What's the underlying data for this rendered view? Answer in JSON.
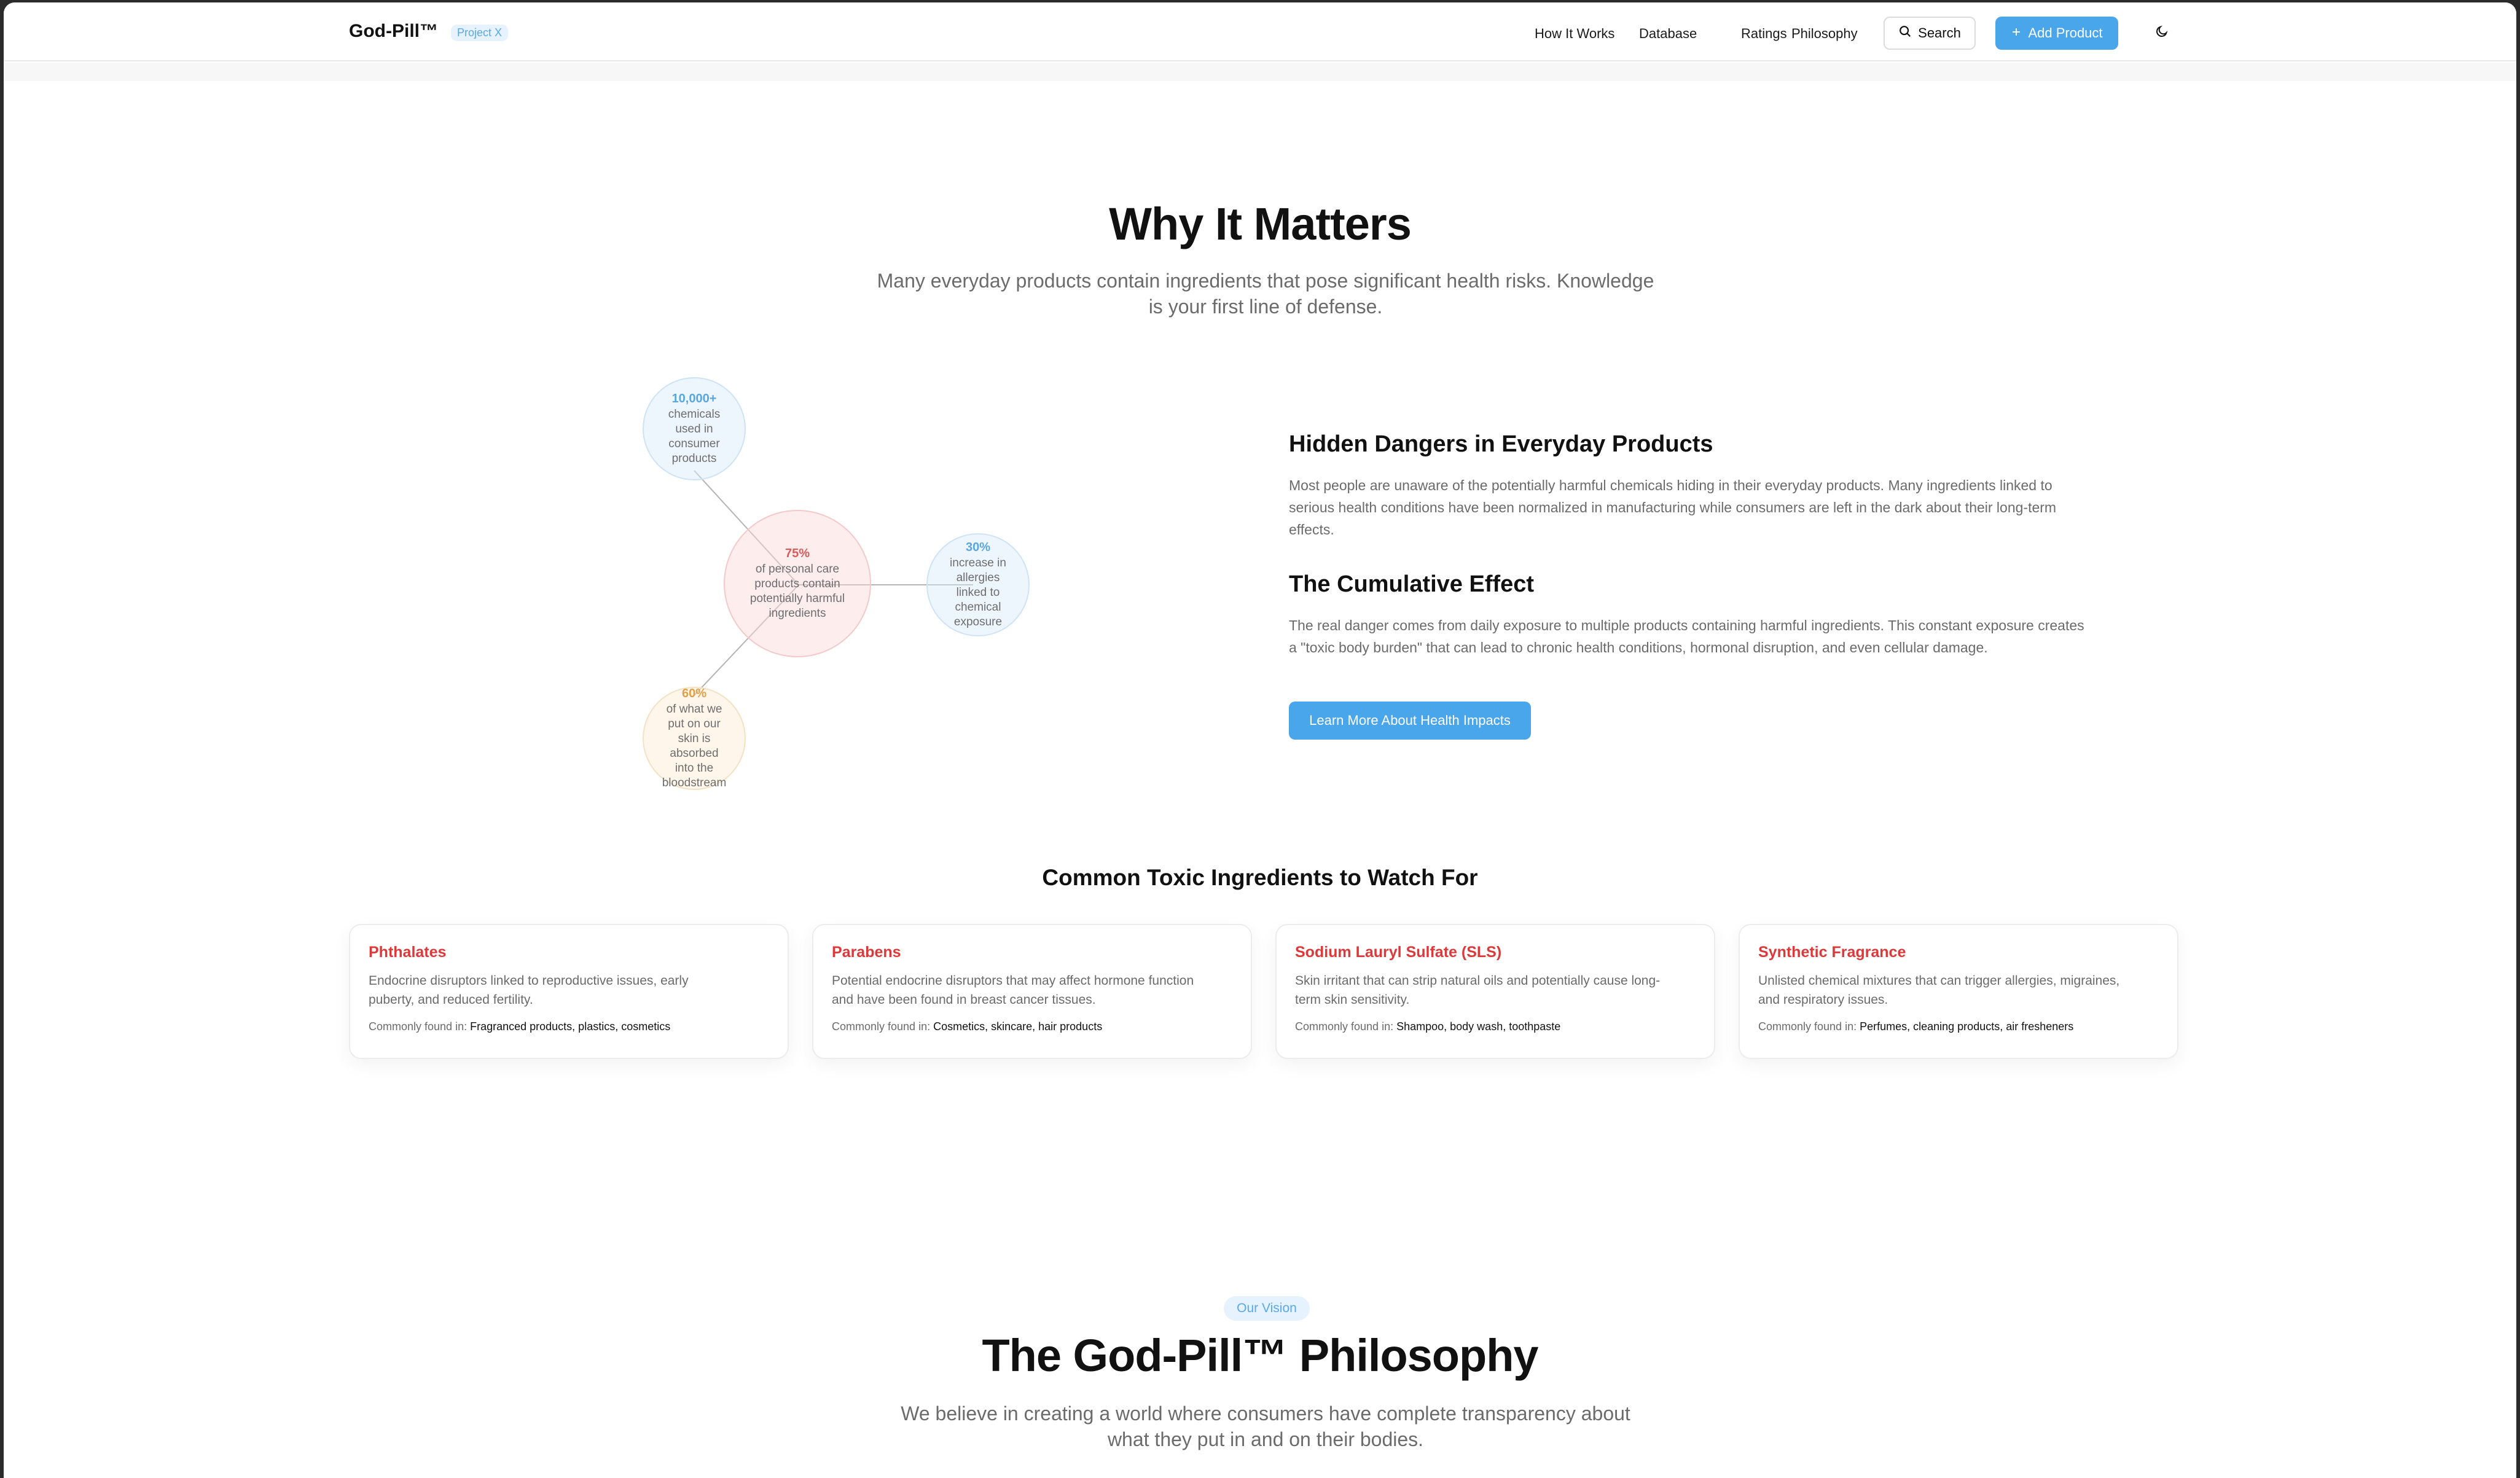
{
  "header": {
    "brand": "God-Pill™",
    "badge": "Project X",
    "nav": [
      "How It Works",
      "Database",
      "Ratings",
      "Philosophy"
    ],
    "search_label": "Search",
    "add_label": "Add Product",
    "icons": {
      "search": "search-icon",
      "add": "plus-icon",
      "theme": "moon-icon"
    }
  },
  "why": {
    "title": "Why It Matters",
    "subtitle_line1": "Many everyday products contain ingredients that pose significant health risks. Knowledge",
    "subtitle_line2": "is your first line of defense."
  },
  "stats": [
    {
      "value": "10,000+",
      "lines": [
        "chemicals",
        "used in",
        "consumer",
        "products"
      ],
      "color": "#5aa7e0"
    },
    {
      "value": "75%",
      "lines": [
        "of personal care",
        "products contain",
        "potentially harmful",
        "ingredients"
      ],
      "color": "#d95b5b"
    },
    {
      "value": "30%",
      "lines": [
        "increase in",
        "allergies",
        "linked to",
        "chemical",
        "exposure"
      ],
      "color": "#5aa7e0"
    },
    {
      "value": "60%",
      "lines": [
        "of what we",
        "put on our",
        "skin is",
        "absorbed",
        "into the",
        "bloodstream"
      ],
      "color": "#e0a046"
    }
  ],
  "info": {
    "h1": "Hidden Dangers in Everyday Products",
    "p1_lines": [
      "Most people are unaware of the potentially harmful chemicals hiding in their everyday products. Many ingredients linked to",
      "serious health conditions have been normalized in manufacturing while consumers are left in the dark about their long-term",
      "effects."
    ],
    "h2": "The Cumulative Effect",
    "p2_lines": [
      "The real danger comes from daily exposure to multiple products containing harmful ingredients. This constant exposure creates",
      "a \"toxic body burden\" that can lead to chronic health conditions, hormonal disruption, and even cellular damage."
    ],
    "button": "Learn More About Health Impacts"
  },
  "toxic": {
    "title": "Common Toxic Ingredients to Watch For",
    "found_label": "Commonly found in:",
    "cards": [
      {
        "name": "Phthalates",
        "desc_lines": [
          "Endocrine disruptors linked to reproductive issues, early",
          "puberty, and reduced fertility."
        ],
        "found": "Fragranced products, plastics, cosmetics"
      },
      {
        "name": "Parabens",
        "desc_lines": [
          "Potential endocrine disruptors that may affect hormone function",
          "and have been found in breast cancer tissues."
        ],
        "found": "Cosmetics, skincare, hair products"
      },
      {
        "name": "Sodium Lauryl Sulfate (SLS)",
        "desc_lines": [
          "Skin irritant that can strip natural oils and potentially cause long-",
          "term skin sensitivity."
        ],
        "found": "Shampoo, body wash, toothpaste"
      },
      {
        "name": "Synthetic Fragrance",
        "desc_lines": [
          "Unlisted chemical mixtures that can trigger allergies, migraines,",
          "and respiratory issues."
        ],
        "found": "Perfumes, cleaning products, air fresheners"
      }
    ]
  },
  "philosophy": {
    "badge": "Our Vision",
    "title": "The God-Pill™ Philosophy",
    "subtitle_line1": "We believe in creating a world where consumers have complete transparency about",
    "subtitle_line2": "what they put in and on their bodies."
  },
  "colors": {
    "accent": "#4aa6ea",
    "danger": "#dc3a3a",
    "muted": "#6b6b6b"
  }
}
